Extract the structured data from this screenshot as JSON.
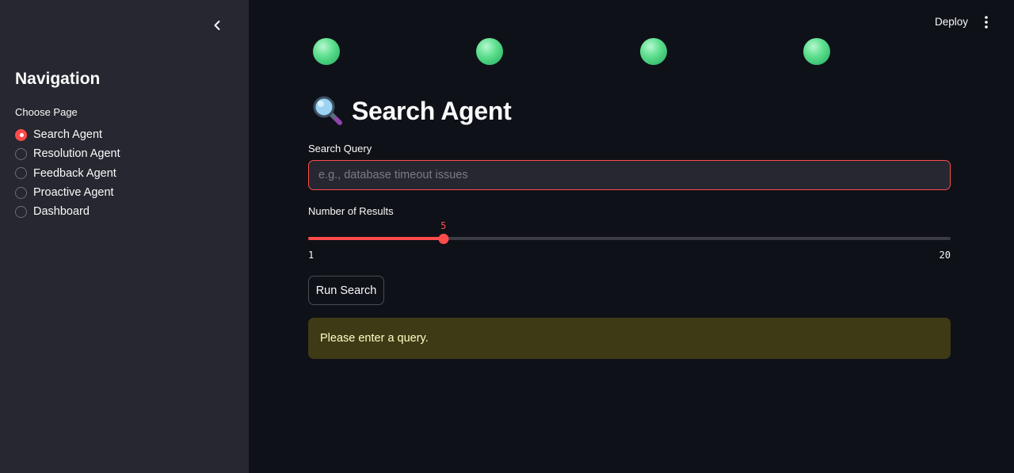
{
  "header": {
    "deploy_label": "Deploy"
  },
  "sidebar": {
    "title": "Navigation",
    "radio_label": "Choose Page",
    "items": [
      {
        "label": "Search Agent",
        "selected": true
      },
      {
        "label": "Resolution Agent",
        "selected": false
      },
      {
        "label": "Feedback Agent",
        "selected": false
      },
      {
        "label": "Proactive Agent",
        "selected": false
      },
      {
        "label": "Dashboard",
        "selected": false
      }
    ]
  },
  "main": {
    "title": "Search Agent",
    "title_icon": "magnifying-glass-emoji",
    "search_label": "Search Query",
    "search_placeholder": "e.g., database timeout issues",
    "search_value": "",
    "slider": {
      "label": "Number of Results",
      "min": 1,
      "max": 20,
      "value": 5,
      "min_label": "1",
      "max_label": "20",
      "value_label": "5"
    },
    "run_button_label": "Run Search",
    "warning_text": "Please enter a query."
  },
  "colors": {
    "accent": "#ff4b4b",
    "background": "#0e1117",
    "sidebar_bg": "#262730",
    "warning_bg": "#3e3a16",
    "warning_text": "#ffffc2",
    "orb": "#5fe08f"
  }
}
